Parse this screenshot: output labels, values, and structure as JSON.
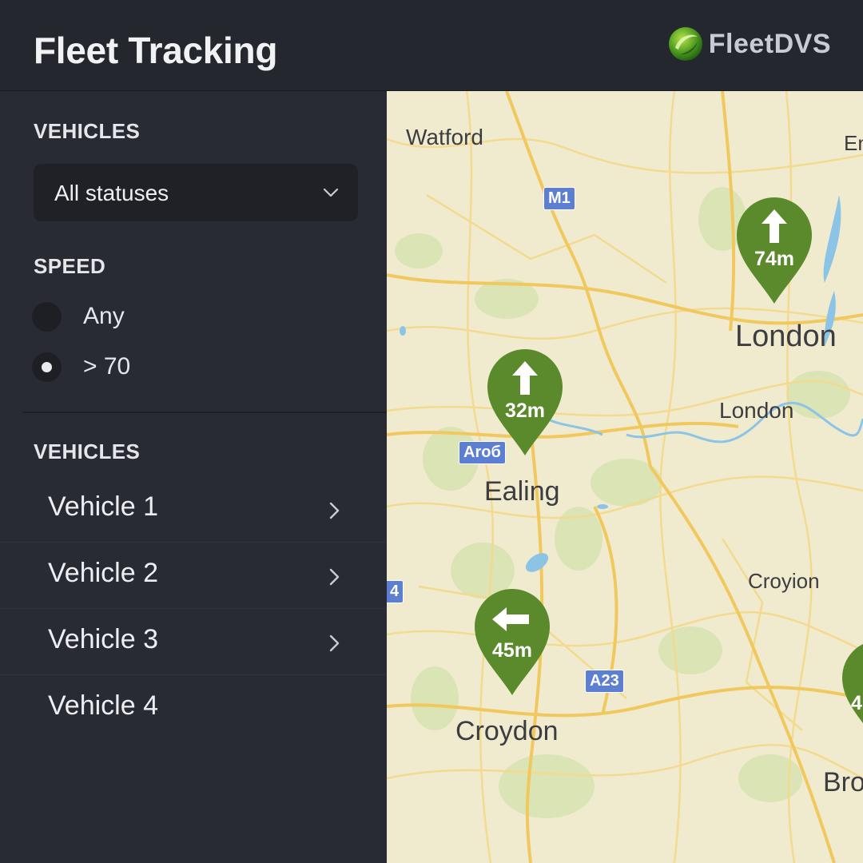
{
  "header": {
    "title": "Fleet Tracking",
    "brand_name": "FleetDVS"
  },
  "filters": {
    "vehicles_heading": "VEHICLES",
    "status_select": {
      "value": "All statuses"
    },
    "speed_heading": "SPEED",
    "speed_options": [
      {
        "label": "Any",
        "selected": false
      },
      {
        "label": "> 70",
        "selected": true
      }
    ]
  },
  "vehicle_list": {
    "heading": "VEHICLES",
    "items": [
      {
        "label": "Vehicle 1"
      },
      {
        "label": "Vehicle 2"
      },
      {
        "label": "Vehicle 3"
      },
      {
        "label": "Vehicle 4"
      }
    ]
  },
  "map": {
    "places": [
      "Watford",
      "En",
      "London",
      "London",
      "Ealing",
      "Croyion",
      "Croydon",
      "Bro"
    ],
    "road_shields": [
      "M1",
      "Aroб",
      "4",
      "A23"
    ],
    "markers": [
      {
        "label": "74m",
        "direction": "up",
        "color": "#5a8a2b"
      },
      {
        "label": "32m",
        "direction": "up",
        "color": "#5a8a2b"
      },
      {
        "label": "45m",
        "direction": "left",
        "color": "#5a8a2b"
      },
      {
        "label": "4",
        "direction": "unknown",
        "color": "#5a8a2b"
      }
    ]
  },
  "colors": {
    "sidebar_bg": "#282b33",
    "header_bg": "#24272e",
    "marker_green": "#5a8a2b",
    "map_land": "#f0ebcf",
    "map_road": "#f3d27a",
    "map_water": "#8cc4e6"
  }
}
